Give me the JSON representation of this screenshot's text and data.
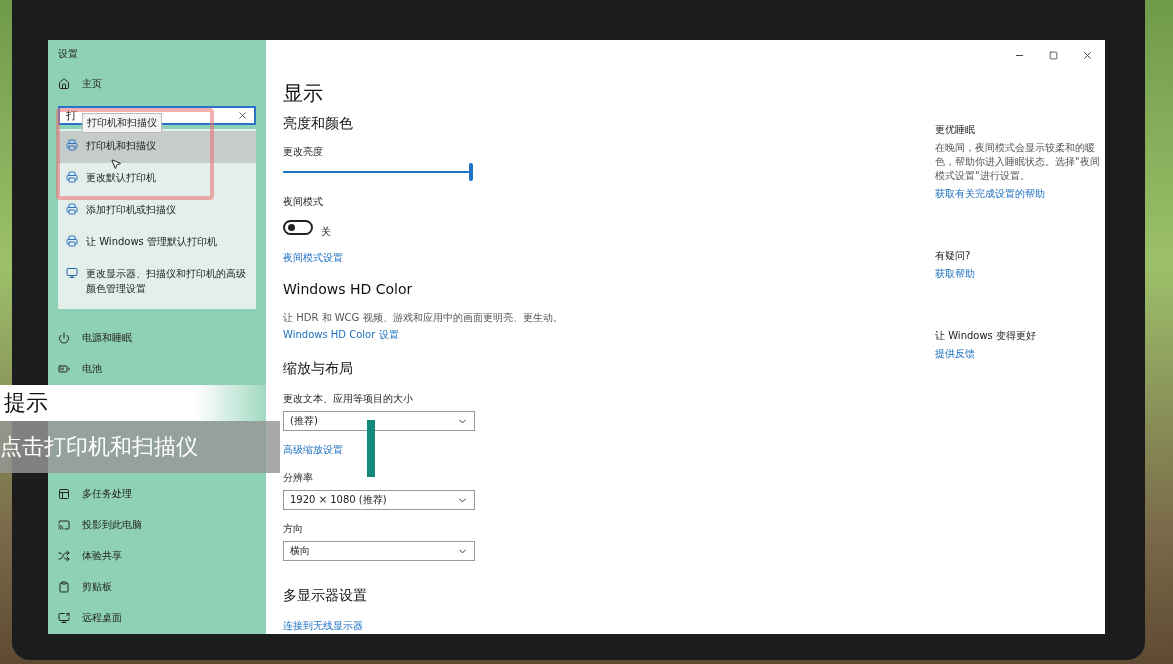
{
  "window": {
    "title": "设置"
  },
  "sidebar": {
    "home": "主页",
    "search": {
      "value": "打",
      "tooltip": "打印机和扫描仪"
    },
    "suggestions": [
      {
        "label": "打印机和扫描仪",
        "kind": "printer",
        "selected": true
      },
      {
        "label": "更改默认打印机",
        "kind": "printer",
        "selected": false
      },
      {
        "label": "添加打印机或扫描仪",
        "kind": "printer",
        "selected": false
      },
      {
        "label": "让 Windows 管理默认打印机",
        "kind": "printer",
        "selected": false
      },
      {
        "label": "更改显示器、扫描仪和打印机的高级颜色管理设置",
        "kind": "display",
        "selected": false
      }
    ],
    "items_top": [
      "电源和睡眠",
      "电池"
    ],
    "items_bottom": [
      "多任务处理",
      "投影到此电脑",
      "体验共享",
      "剪贴板",
      "远程桌面"
    ]
  },
  "main": {
    "heading": "显示",
    "brightness": {
      "title": "亮度和颜色",
      "label": "更改亮度",
      "level": 1.0
    },
    "night": {
      "label": "夜间模式",
      "on": false,
      "state": "关",
      "link": "夜间模式设置"
    },
    "hd": {
      "title": "Windows HD Color",
      "text": "让 HDR 和 WCG 视频、游戏和应用中的画面更明亮、更生动。",
      "link": "Windows HD Color 设置"
    },
    "scale": {
      "title": "缩放与布局",
      "size_label": "更改文本、应用等项目的大小",
      "size_value": "(推荐)",
      "advanced_link": "高级缩放设置",
      "resolution_label": "分辨率",
      "resolution_value": "1920 × 1080 (推荐)",
      "orientation_label": "方向",
      "orientation_value": "横向"
    },
    "multi": {
      "title": "多显示器设置",
      "link": "连接到无线显示器"
    }
  },
  "aside": [
    {
      "title": "更优睡眠",
      "text": "在晚间，夜间模式会显示较柔和的暖色，帮助你进入睡眠状态。选择\"夜间模式设置\"进行设置。",
      "link": "获取有关完成设置的帮助"
    },
    {
      "title": "有疑问?",
      "link": "获取帮助"
    },
    {
      "title": "让 Windows 变得更好",
      "link": "提供反馈"
    }
  ],
  "caption": {
    "title": "提示",
    "text": "点击打印机和扫描仪"
  }
}
